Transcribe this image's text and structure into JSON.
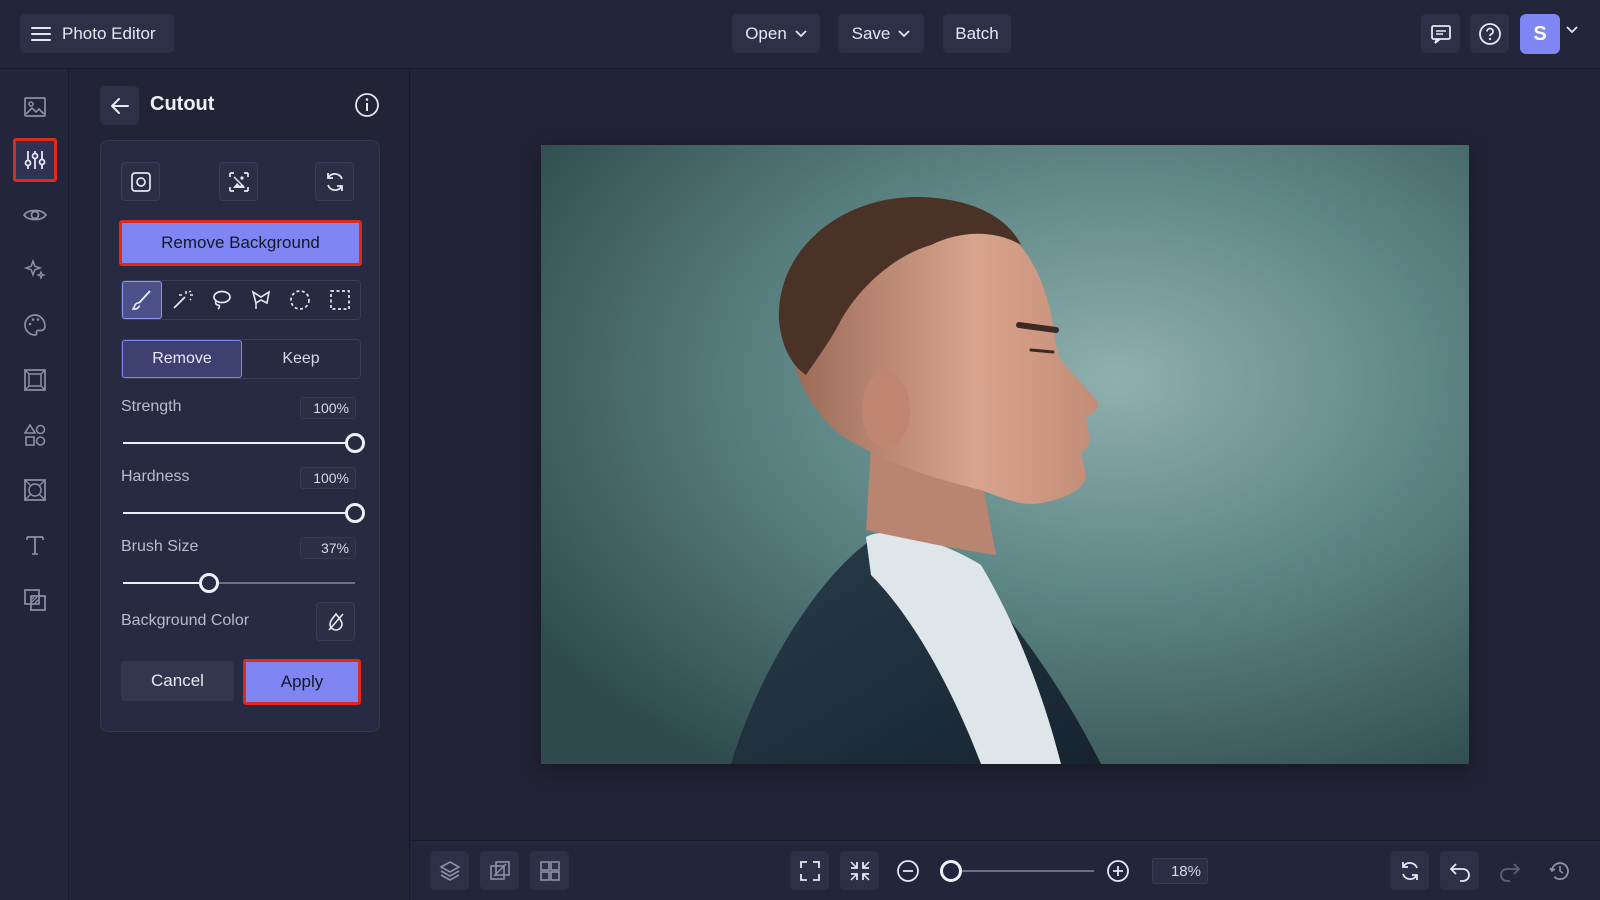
{
  "app": {
    "title": "Photo Editor"
  },
  "topbar": {
    "open_label": "Open",
    "save_label": "Save",
    "batch_label": "Batch",
    "avatar_initial": "S"
  },
  "rail": {
    "active_item": "adjustments",
    "items": [
      "image",
      "adjustments",
      "eye",
      "effects",
      "artsy",
      "frames",
      "graphics",
      "textures",
      "text",
      "overlays"
    ]
  },
  "panel": {
    "title": "Cutout",
    "remove_background_label": "Remove Background",
    "active_tool": "brush",
    "tools": [
      "brush",
      "magic-wand",
      "lasso",
      "polygon-lasso",
      "ellipse-select",
      "rectangle-select"
    ],
    "mode": {
      "remove_label": "Remove",
      "keep_label": "Keep",
      "selected": "Remove"
    },
    "strength": {
      "label": "Strength",
      "value_text": "100%",
      "value": 100
    },
    "hardness": {
      "label": "Hardness",
      "value_text": "100%",
      "value": 100
    },
    "brush_size": {
      "label": "Brush Size",
      "value_text": "37%",
      "value": 37
    },
    "background_color_label": "Background Color",
    "cancel_label": "Cancel",
    "apply_label": "Apply"
  },
  "canvas": {
    "photo_subject": "man in profile against teal background"
  },
  "bottombar": {
    "zoom_text": "18%",
    "zoom_value": 18
  },
  "colors": {
    "accent": "#7f86f3",
    "highlight": "#e0291d",
    "background": "#222436"
  }
}
